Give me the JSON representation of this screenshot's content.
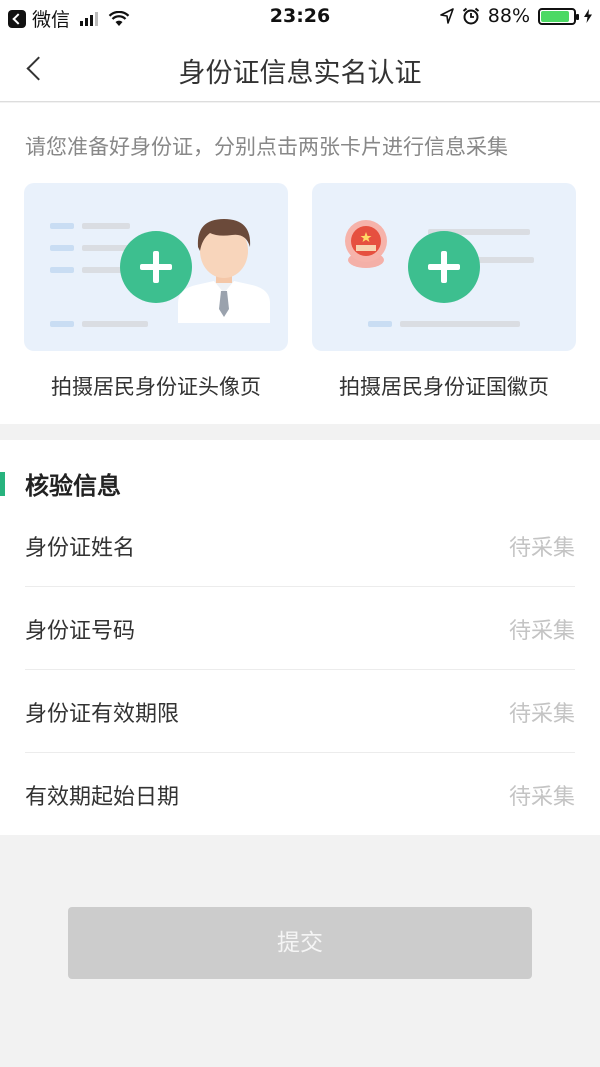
{
  "status_bar": {
    "back_app": "微信",
    "time": "23:26",
    "battery": "88%"
  },
  "nav": {
    "title": "身份证信息实名认证"
  },
  "capture": {
    "instruction": "请您准备好身份证，分别点击两张卡片进行信息采集",
    "front_label": "拍摄居民身份证头像页",
    "back_label": "拍摄居民身份证国徽页"
  },
  "verify": {
    "title": "核验信息",
    "rows": [
      {
        "label": "身份证姓名",
        "value": "待采集"
      },
      {
        "label": "身份证号码",
        "value": "待采集"
      },
      {
        "label": "身份证有效期限",
        "value": "待采集"
      },
      {
        "label": "有效期起始日期",
        "value": "待采集"
      }
    ]
  },
  "submit_label": "提交",
  "colors": {
    "accent": "#3dbf8f",
    "section_accent": "#27b37e",
    "card_bg": "#e9f1fb",
    "submit_disabled": "#cccccc",
    "battery": "#4cd964"
  }
}
